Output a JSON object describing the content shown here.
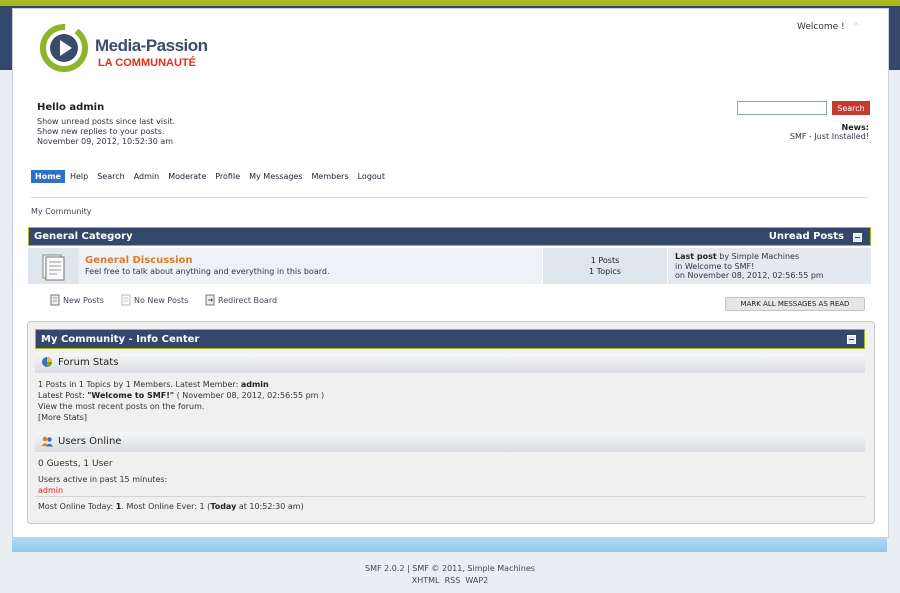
{
  "header": {
    "logo_main": "Media-",
    "logo_main2": "Passion",
    "logo_sub": "LA COMMUNAUTÉ",
    "welcome": "Welcome !"
  },
  "user": {
    "greeting": "Hello admin",
    "links": [
      "Show unread posts since last visit.",
      "Show new replies to your posts."
    ],
    "datetime": "November 09, 2012, 10:52:30 am"
  },
  "search": {
    "value": "",
    "button": "Search"
  },
  "news": {
    "label": "News:",
    "text": "SMF - Just Installed!"
  },
  "menu": [
    "Home",
    "Help",
    "Search",
    "Admin",
    "Moderate",
    "Profile",
    "My Messages",
    "Members",
    "Logout"
  ],
  "breadcrumb": "My Community",
  "category": {
    "title": "General Category",
    "unread": "Unread Posts",
    "boards": [
      {
        "name": "General Discussion",
        "description": "Feel free to talk about anything and everything in this board.",
        "posts": "1 Posts",
        "topics": "1 Topics",
        "last_post_label": "Last post",
        "last_post_by": "by Simple Machines",
        "last_post_in": "in Welcome to SMF!",
        "last_post_on": "on November 08, 2012, 02:56:55 pm"
      }
    ]
  },
  "legend": {
    "new_posts": "New Posts",
    "no_new_posts": "No New Posts",
    "redirect": "Redirect Board"
  },
  "mark_read": "MARK ALL MESSAGES AS READ",
  "info_center": {
    "title": "My Community - Info Center",
    "forum_stats_title": "Forum Stats",
    "stats_line1_pre": "1 Posts in 1 Topics by 1 Members. Latest Member:",
    "stats_latest_member": "admin",
    "stats_line2_pre": "Latest Post:",
    "stats_latest_post": "\"Welcome to SMF!\"",
    "stats_line2_post": "( November 08, 2012, 02:56:55 pm )",
    "stats_line3": "View the most recent posts on the forum.",
    "stats_more": "[More Stats]",
    "users_online_title": "Users Online",
    "users_count": "0 Guests, 1 User",
    "users_active": "Users active in past 15 minutes:",
    "users_active_name": "admin",
    "most_online_pre": "Most Online Today:",
    "most_online_today": "1",
    "most_online_mid": ". Most Online Ever: 1 (",
    "most_online_ever_label": "Today",
    "most_online_post": "at 10:52:30 am)"
  },
  "footer": {
    "line1": "SMF 2.0.2 | SMF © 2011, Simple Machines",
    "links": [
      "XHTML",
      "RSS",
      "WAP2"
    ]
  },
  "colors": {
    "navy": "#35476a",
    "lime": "#a9b81c",
    "search_button": "#c53a2e",
    "board_link": "#dd7a22",
    "menu_active": "#2f6fc6"
  }
}
